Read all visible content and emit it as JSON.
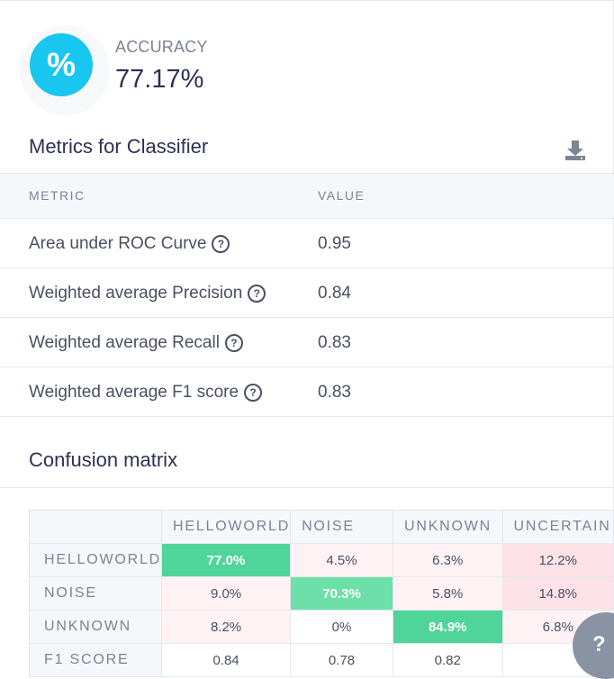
{
  "accuracy": {
    "icon": "percent-icon",
    "label": "ACCURACY",
    "value": "77.17%"
  },
  "metrics": {
    "title": "Metrics for Classifier",
    "download_icon": "download-icon",
    "columns": [
      "METRIC",
      "VALUE"
    ],
    "rows": [
      {
        "name": "Area under ROC Curve",
        "value": "0.95"
      },
      {
        "name": "Weighted average Precision",
        "value": "0.84"
      },
      {
        "name": "Weighted average Recall",
        "value": "0.83"
      },
      {
        "name": "Weighted average F1 score",
        "value": "0.83"
      }
    ]
  },
  "confusion": {
    "title": "Confusion matrix",
    "columns": [
      "HELLOWORLD",
      "NOISE",
      "UNKNOWN",
      "UNCERTAIN"
    ],
    "rows": [
      {
        "label": "HELLOWORLD",
        "cells": [
          "77.0%",
          "4.5%",
          "6.3%",
          "12.2%"
        ]
      },
      {
        "label": "NOISE",
        "cells": [
          "9.0%",
          "70.3%",
          "5.8%",
          "14.8%"
        ]
      },
      {
        "label": "UNKNOWN",
        "cells": [
          "8.2%",
          "0%",
          "84.9%",
          "6.8%"
        ]
      }
    ],
    "f1_row": {
      "label": "F1 SCORE",
      "cells": [
        "0.84",
        "0.78",
        "0.82",
        ""
      ]
    },
    "colors": {
      "correct_strong": "#4fd49a",
      "correct_light": "#6ddfa9",
      "miss_high": "#fde3e7",
      "miss_low": "#fff2f4",
      "zero": "#ffffff"
    }
  },
  "help": {
    "icon": "help-icon",
    "label": "?"
  }
}
